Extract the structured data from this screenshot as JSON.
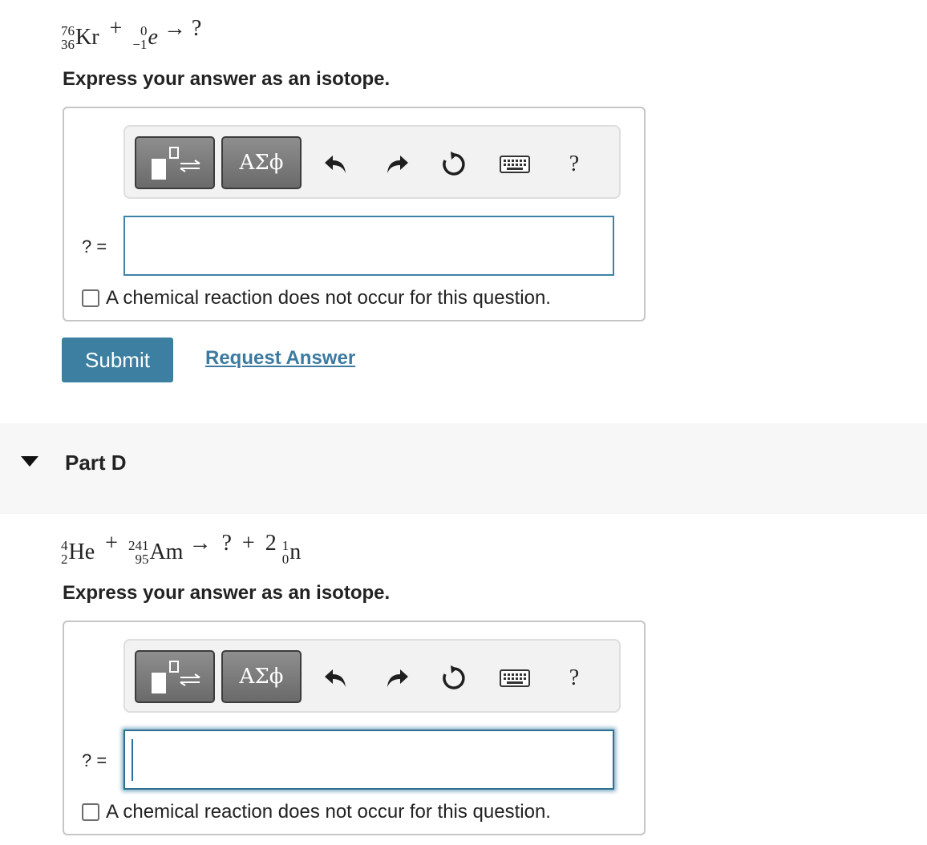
{
  "partC": {
    "equation": {
      "kr": {
        "mass": "76",
        "atomic": "36",
        "symbol": "Kr"
      },
      "plus": "+",
      "e": {
        "mass": "0",
        "atomic": "−1",
        "symbol": "e"
      },
      "arrow": "→",
      "result": "?"
    },
    "instruction": "Express your answer as an isotope.",
    "answer_label": "? =",
    "answer_value": "",
    "no_reaction_label": "A chemical reaction does not occur for this question.",
    "submit_label": "Submit",
    "request_label": "Request Answer"
  },
  "toolbar": {
    "greek_label": "ΑΣϕ",
    "help_label": "?",
    "icons": [
      "templates-icon",
      "greek-icon",
      "undo-icon",
      "redo-icon",
      "reset-icon",
      "keyboard-icon",
      "help-icon"
    ]
  },
  "partD": {
    "title": "Part D",
    "equation": {
      "he": {
        "mass": "4",
        "atomic": "2",
        "symbol": "He"
      },
      "plus1": "+",
      "am": {
        "mass": "241",
        "atomic": "95",
        "symbol": "Am"
      },
      "arrow": "→",
      "unknown": "?",
      "plus2": "+",
      "coef": "2",
      "n": {
        "mass": "1",
        "atomic": "0",
        "symbol": "n"
      }
    },
    "instruction": "Express your answer as an isotope.",
    "answer_label": "? =",
    "answer_value": "",
    "no_reaction_label": "A chemical reaction does not occur for this question."
  },
  "colors": {
    "accent": "#3d7fa0",
    "link": "#3c7aa0",
    "band": "#f7f7f7"
  }
}
